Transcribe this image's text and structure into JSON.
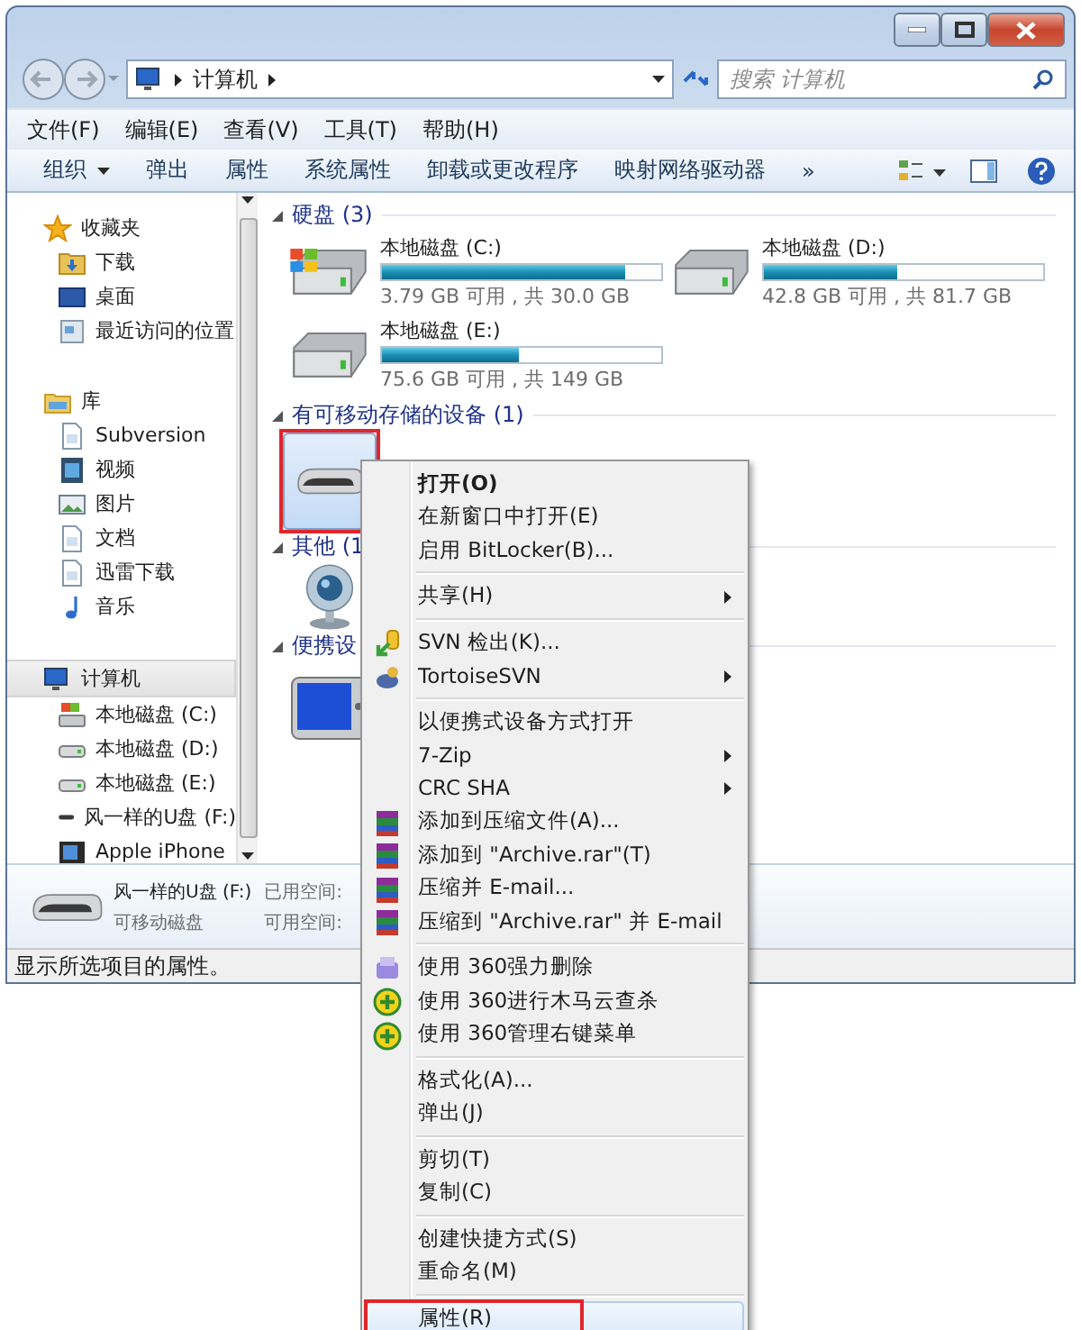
{
  "address": {
    "crumb": "计算机"
  },
  "search": {
    "placeholder": "搜索 计算机"
  },
  "menu_bar": [
    "文件(F)",
    "编辑(E)",
    "查看(V)",
    "工具(T)",
    "帮助(H)"
  ],
  "toolbar": [
    {
      "label": "组织",
      "dropdown": true
    },
    {
      "label": "弹出",
      "dropdown": false
    },
    {
      "label": "属性",
      "dropdown": false
    },
    {
      "label": "系统属性",
      "dropdown": false
    },
    {
      "label": "卸载或更改程序",
      "dropdown": false
    },
    {
      "label": "映射网络驱动器",
      "dropdown": false
    },
    {
      "label": "»",
      "dropdown": false
    }
  ],
  "sidebar": [
    {
      "label": "收藏夹",
      "kind": "star",
      "selected": false,
      "children": [
        {
          "label": "下载",
          "kind": "download"
        },
        {
          "label": "桌面",
          "kind": "desktop"
        },
        {
          "label": "最近访问的位置",
          "kind": "recent"
        }
      ]
    },
    {
      "label": "库",
      "kind": "library",
      "selected": false,
      "children": [
        {
          "label": "Subversion",
          "kind": "doc"
        },
        {
          "label": "视频",
          "kind": "video"
        },
        {
          "label": "图片",
          "kind": "image"
        },
        {
          "label": "文档",
          "kind": "doc"
        },
        {
          "label": "迅雷下载",
          "kind": "doc"
        },
        {
          "label": "音乐",
          "kind": "music"
        }
      ]
    },
    {
      "label": "计算机",
      "kind": "computer",
      "selected": true,
      "children": [
        {
          "label": "本地磁盘 (C:)",
          "kind": "system"
        },
        {
          "label": "本地磁盘 (D:)",
          "kind": "drive"
        },
        {
          "label": "本地磁盘 (E:)",
          "kind": "drive"
        },
        {
          "label": "风一样的U盘 (F:)",
          "kind": "usb"
        },
        {
          "label": "Apple iPhone",
          "kind": "phone"
        }
      ]
    }
  ],
  "sections": [
    {
      "title": "硬盘 (3)",
      "items": [
        {
          "kind": "system",
          "name": "本地磁盘 (C:)",
          "level": 0.87,
          "reading": "3.79 GB 可用 , 共 30.0 GB"
        },
        {
          "kind": "drive",
          "name": "本地磁盘 (D:)",
          "level": 0.48,
          "reading": "42.8 GB 可用 , 共 81.7 GB"
        },
        {
          "kind": "drive",
          "name": "本地磁盘 (E:)",
          "level": 0.49,
          "reading": "75.6 GB 可用 , 共 149 GB"
        }
      ]
    },
    {
      "title": "有可移动存储的设备 (1)",
      "items": [
        {
          "kind": "usb",
          "selected": true
        }
      ]
    },
    {
      "title": "其他 (1",
      "items": [
        {
          "kind": "webcam",
          "selected": false
        }
      ]
    },
    {
      "title": "便携设",
      "items": [
        {
          "kind": "player",
          "selected": false
        }
      ]
    }
  ],
  "details": {
    "name": "风一样的U盘 (F:)",
    "type": "可移动磁盘",
    "field_1": "已用空间:",
    "field_2": "可用空间:"
  },
  "status_bar": "显示所选项目的属性。",
  "context_menu": [
    [
      {
        "label": "打开(O)",
        "bold": true,
        "kind": "plain",
        "submenu": false,
        "selected": false
      },
      {
        "label": "在新窗口中打开(E)",
        "bold": false,
        "kind": "plain",
        "submenu": false,
        "selected": false
      },
      {
        "label": "启用 BitLocker(B)...",
        "bold": false,
        "kind": "plain",
        "submenu": false,
        "selected": false
      }
    ],
    [
      {
        "label": "共享(H)",
        "bold": false,
        "kind": "plain",
        "submenu": true,
        "selected": false
      }
    ],
    [
      {
        "label": "SVN 检出(K)...",
        "bold": false,
        "kind": "svn",
        "submenu": false,
        "selected": false
      },
      {
        "label": "TortoiseSVN",
        "bold": false,
        "kind": "tortoise",
        "submenu": true,
        "selected": false
      }
    ],
    [
      {
        "label": "以便携式设备方式打开",
        "bold": false,
        "kind": "plain",
        "submenu": false,
        "selected": false
      },
      {
        "label": "7-Zip",
        "bold": false,
        "kind": "plain",
        "submenu": true,
        "selected": false
      },
      {
        "label": "CRC SHA",
        "bold": false,
        "kind": "plain",
        "submenu": true,
        "selected": false
      },
      {
        "label": "添加到压缩文件(A)...",
        "bold": false,
        "kind": "rar",
        "submenu": false,
        "selected": false
      },
      {
        "label": "添加到 \"Archive.rar\"(T)",
        "bold": false,
        "kind": "rar",
        "submenu": false,
        "selected": false
      },
      {
        "label": "压缩并 E-mail...",
        "bold": false,
        "kind": "rar",
        "submenu": false,
        "selected": false
      },
      {
        "label": "压缩到 \"Archive.rar\" 并 E-mail",
        "bold": false,
        "kind": "rar",
        "submenu": false,
        "selected": false
      }
    ],
    [
      {
        "label": "使用 360强力删除",
        "bold": false,
        "kind": "shred",
        "submenu": false,
        "selected": false
      },
      {
        "label": "使用 360进行木马云查杀",
        "bold": false,
        "kind": "plus",
        "submenu": false,
        "selected": false
      },
      {
        "label": "使用 360管理右键菜单",
        "bold": false,
        "kind": "plus",
        "submenu": false,
        "selected": false
      }
    ],
    [
      {
        "label": "格式化(A)...",
        "bold": false,
        "kind": "plain",
        "submenu": false,
        "selected": false
      },
      {
        "label": "弹出(J)",
        "bold": false,
        "kind": "plain",
        "submenu": false,
        "selected": false
      }
    ],
    [
      {
        "label": "剪切(T)",
        "bold": false,
        "kind": "plain",
        "submenu": false,
        "selected": false
      },
      {
        "label": "复制(C)",
        "bold": false,
        "kind": "plain",
        "submenu": false,
        "selected": false
      }
    ],
    [
      {
        "label": "创建快捷方式(S)",
        "bold": false,
        "kind": "plain",
        "submenu": false,
        "selected": false
      },
      {
        "label": "重命名(M)",
        "bold": false,
        "kind": "plain",
        "submenu": false,
        "selected": false
      }
    ],
    [
      {
        "label": "属性(R)",
        "bold": false,
        "kind": "plain",
        "submenu": false,
        "selected": true
      }
    ]
  ]
}
